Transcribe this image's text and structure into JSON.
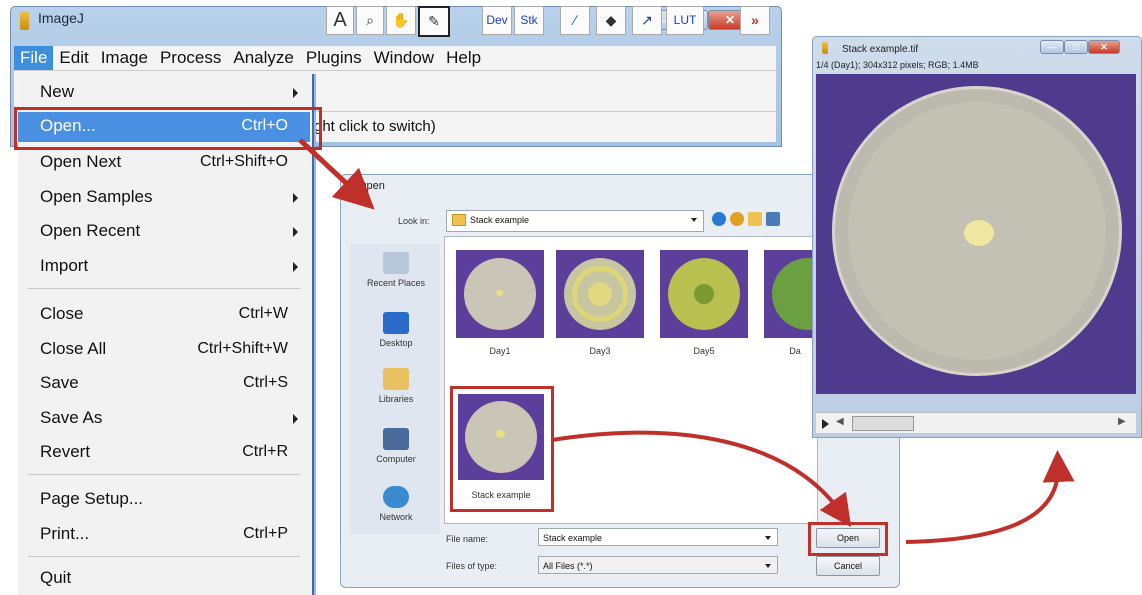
{
  "imagej": {
    "title": "ImageJ",
    "menubar": [
      "File",
      "Edit",
      "Image",
      "Process",
      "Analyze",
      "Plugins",
      "Window",
      "Help"
    ],
    "tools": {
      "text": "A",
      "zoom": "⌕",
      "hand": "✋",
      "dropper": "✎",
      "dev": "Dev",
      "stk": "Stk",
      "brush": "∕",
      "fill": "◆",
      "arrow": "↗",
      "lut": "LUT",
      "more": "»"
    },
    "status": "ght click to switch)"
  },
  "file_menu": {
    "items": [
      {
        "label": "New",
        "shortcut": "",
        "submenu": true
      },
      {
        "label": "Open...",
        "shortcut": "Ctrl+O",
        "submenu": false
      },
      {
        "label": "Open Next",
        "shortcut": "Ctrl+Shift+O",
        "submenu": false
      },
      {
        "label": "Open Samples",
        "shortcut": "",
        "submenu": true
      },
      {
        "label": "Open Recent",
        "shortcut": "",
        "submenu": true
      },
      {
        "label": "Import",
        "shortcut": "",
        "submenu": true
      },
      {
        "label": "Close",
        "shortcut": "Ctrl+W",
        "submenu": false
      },
      {
        "label": "Close All",
        "shortcut": "Ctrl+Shift+W",
        "submenu": false
      },
      {
        "label": "Save",
        "shortcut": "Ctrl+S",
        "submenu": false
      },
      {
        "label": "Save As",
        "shortcut": "",
        "submenu": true
      },
      {
        "label": "Revert",
        "shortcut": "Ctrl+R",
        "submenu": false
      },
      {
        "label": "Page Setup...",
        "shortcut": "",
        "submenu": false
      },
      {
        "label": "Print...",
        "shortcut": "Ctrl+P",
        "submenu": false
      },
      {
        "label": "Quit",
        "shortcut": "",
        "submenu": false
      }
    ]
  },
  "open_dialog": {
    "title": "Open",
    "look_in_label": "Look in:",
    "look_in_value": "Stack example",
    "places": [
      "Recent Places",
      "Desktop",
      "Libraries",
      "Computer",
      "Network"
    ],
    "files": [
      "Day1",
      "Day3",
      "Day5",
      "Da",
      "Stack example"
    ],
    "file_name_label": "File name:",
    "file_name_value": "Stack example",
    "file_type_label": "Files of type:",
    "file_type_value": "All Files (*.*)",
    "open_button": "Open",
    "cancel_button": "Cancel"
  },
  "stack_window": {
    "title": "Stack example.tif",
    "info": "1/4 (Day1); 304x312 pixels; RGB; 1.4MB"
  },
  "colors": {
    "highlight": "#4a90e2",
    "annotation": "#c0302a",
    "dish_background": "#4e3b8e"
  }
}
